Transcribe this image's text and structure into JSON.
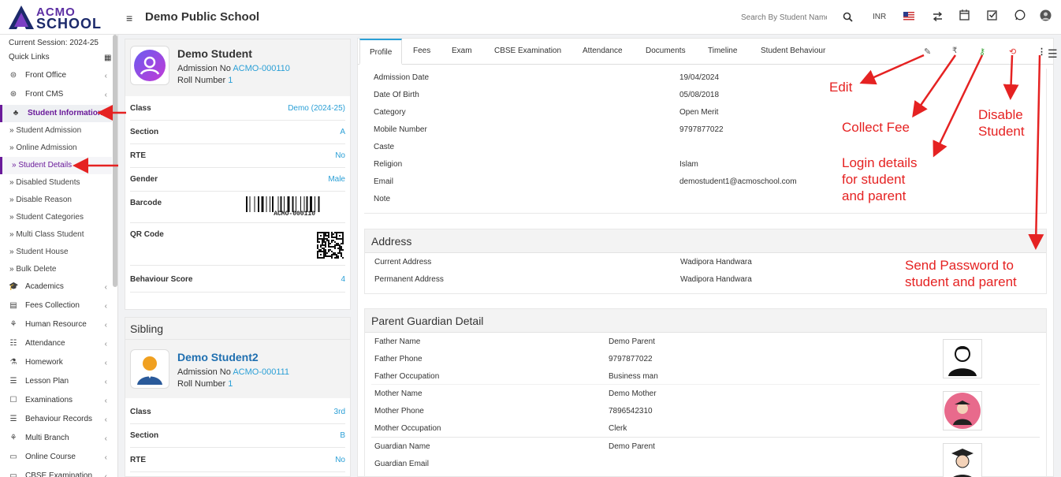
{
  "logo": {
    "line1": "ACMO",
    "line2": "SCHOOL"
  },
  "header": {
    "school_name": "Demo Public School",
    "search_placeholder": "Search By Student Name",
    "currency": "INR"
  },
  "sidebar": {
    "session": "Current Session: 2024-25",
    "quick_links": "Quick Links",
    "top_items": [
      {
        "label": "Front Office",
        "icon": "front-office-icon"
      },
      {
        "label": "Front CMS",
        "icon": "front-cms-icon"
      },
      {
        "label": "Student Information",
        "icon": "student-info-icon"
      }
    ],
    "sub_items": [
      {
        "label": "Student Admission"
      },
      {
        "label": "Online Admission"
      },
      {
        "label": "Student Details"
      },
      {
        "label": "Disabled Students"
      },
      {
        "label": "Disable Reason"
      },
      {
        "label": "Student Categories"
      },
      {
        "label": "Multi Class Student"
      },
      {
        "label": "Student House"
      },
      {
        "label": "Bulk Delete"
      }
    ],
    "bottom_items": [
      {
        "label": "Academics"
      },
      {
        "label": "Fees Collection"
      },
      {
        "label": "Human Resource"
      },
      {
        "label": "Attendance"
      },
      {
        "label": "Homework"
      },
      {
        "label": "Lesson Plan"
      },
      {
        "label": "Examinations"
      },
      {
        "label": "Behaviour Records"
      },
      {
        "label": "Multi Branch"
      },
      {
        "label": "Online Course"
      },
      {
        "label": "CBSE Examination"
      }
    ]
  },
  "student": {
    "name": "Demo Student",
    "admission_label": "Admission No",
    "admission_no": "ACMO-000110",
    "roll_label": "Roll Number",
    "roll_no": "1",
    "fields": [
      {
        "k": "Class",
        "v": "Demo (2024-25)"
      },
      {
        "k": "Section",
        "v": "A"
      },
      {
        "k": "RTE",
        "v": "No"
      },
      {
        "k": "Gender",
        "v": "Male"
      },
      {
        "k": "Barcode",
        "v": ""
      },
      {
        "k": "QR Code",
        "v": ""
      },
      {
        "k": "Behaviour Score",
        "v": "4"
      }
    ],
    "barcode_text": "ACMO-000110"
  },
  "sibling": {
    "title": "Sibling",
    "name": "Demo Student2",
    "admission_label": "Admission No",
    "admission_no": "ACMO-000111",
    "roll_label": "Roll Number",
    "roll_no": "1",
    "fields": [
      {
        "k": "Class",
        "v": "3rd"
      },
      {
        "k": "Section",
        "v": "B"
      },
      {
        "k": "RTE",
        "v": "No"
      }
    ]
  },
  "tabs": [
    "Profile",
    "Fees",
    "Exam",
    "CBSE Examination",
    "Attendance",
    "Documents",
    "Timeline",
    "Student Behaviour"
  ],
  "profile": [
    {
      "k": "Admission Date",
      "v": "19/04/2024"
    },
    {
      "k": "Date Of Birth",
      "v": "05/08/2018"
    },
    {
      "k": "Category",
      "v": "Open Merit"
    },
    {
      "k": "Mobile Number",
      "v": "9797877022"
    },
    {
      "k": "Caste",
      "v": ""
    },
    {
      "k": "Religion",
      "v": "Islam"
    },
    {
      "k": "Email",
      "v": "demostudent1@acmoschool.com"
    },
    {
      "k": "Note",
      "v": ""
    }
  ],
  "address": {
    "title": "Address",
    "rows": [
      {
        "k": "Current Address",
        "v": "Wadipora Handwara"
      },
      {
        "k": "Permanent Address",
        "v": "Wadipora Handwara"
      }
    ]
  },
  "guardian": {
    "title": "Parent Guardian Detail",
    "rows": [
      {
        "k": "Father Name",
        "v": "Demo Parent"
      },
      {
        "k": "Father Phone",
        "v": "9797877022"
      },
      {
        "k": "Father Occupation",
        "v": "Business man"
      },
      {
        "k": "Mother Name",
        "v": "Demo Mother"
      },
      {
        "k": "Mother Phone",
        "v": "7896542310"
      },
      {
        "k": "Mother Occupation",
        "v": "Clerk"
      },
      {
        "k": "Guardian Name",
        "v": "Demo Parent"
      },
      {
        "k": "Guardian Email",
        "v": ""
      }
    ]
  },
  "annotations": {
    "edit": "Edit",
    "collect_fee": "Collect Fee",
    "disable_l1": "Disable",
    "disable_l2": "Student",
    "login_l1": "Login details",
    "login_l2": "for student",
    "login_l3": "and parent",
    "send_l1": "Send Password to",
    "send_l2": "student and parent"
  },
  "colors": {
    "brand": "#6a1b9a",
    "accent": "#2a9fd6",
    "annotation": "#e52222"
  }
}
